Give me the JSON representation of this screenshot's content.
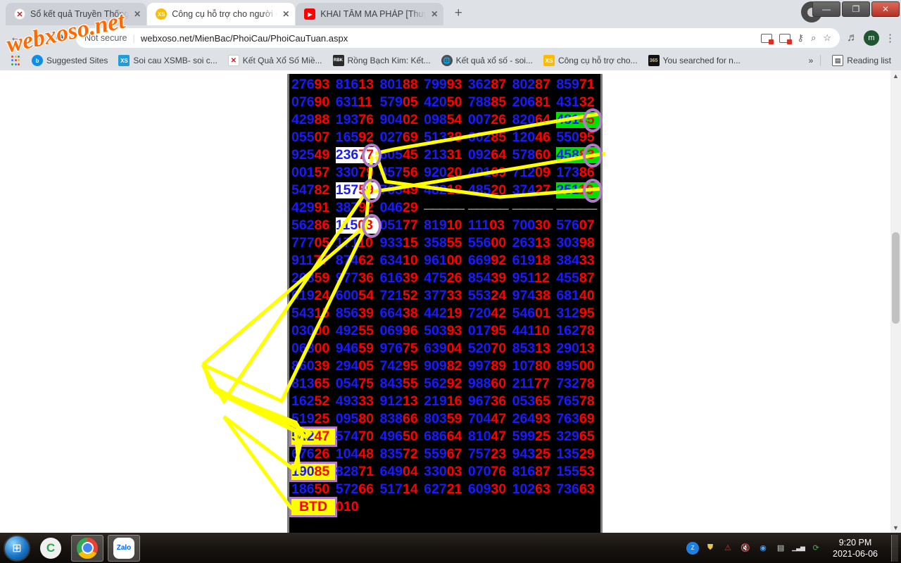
{
  "window": {
    "minimize_label": "—",
    "maximize_label": "❐",
    "close_label": "✕"
  },
  "tabs": [
    {
      "title": "Sổ kết quả Truyền Thống",
      "favicon": "xs-red-icon",
      "active": false,
      "close_label": "✕"
    },
    {
      "title": "Công cụ hỗ trợ cho người chơi xổ",
      "favicon": "xs-yellow-icon",
      "active": true,
      "close_label": "✕"
    },
    {
      "title": "KHAI TÂM MA PHÁP [Thuyết Min",
      "favicon": "youtube-icon",
      "active": false,
      "close_label": "✕"
    }
  ],
  "newtab_label": "+",
  "toolbar": {
    "back_label": "←",
    "forward_label": "→",
    "reload_label": "⟳",
    "security_label": "Not secure",
    "separator": "|",
    "url": "webxoso.net/MienBac/PhoiCau/PhoiCauTuan.aspx",
    "zoom_label": "⌕",
    "bookmark_label": "☆",
    "key_label": "⚷",
    "media_label": "♬",
    "profile_initial": "m",
    "menu_label": "⋮"
  },
  "bookmarks": {
    "apps_label": "",
    "items": [
      {
        "label": "Suggested Sites",
        "icon": "bing-icon"
      },
      {
        "label": "Soi cau XSMB- soi c...",
        "icon": "xs-blue-icon"
      },
      {
        "label": "Kết Quả Xổ Số Miề...",
        "icon": "ketqua-icon"
      },
      {
        "label": "Rồng Bạch Kim: Kết...",
        "icon": "rbk-icon"
      },
      {
        "label": "Kết quả xổ số - soi...",
        "icon": "globe-icon"
      },
      {
        "label": "Công cụ hỗ trợ cho...",
        "icon": "xs-yellow-icon"
      },
      {
        "label": "You searched for n...",
        "icon": "365-icon"
      }
    ],
    "overflow_label": "»",
    "reading_list_label": "Reading list",
    "reading_list_icon": "reading-list-icon"
  },
  "watermark": "webxoso.net",
  "page": {
    "grid": [
      {
        "cells": [
          {
            "b": "276",
            "r": "93"
          },
          {
            "b": "816",
            "r": "13"
          },
          {
            "b": "801",
            "r": "88"
          },
          {
            "b": "799",
            "r": "93"
          },
          {
            "b": "362",
            "r": "87"
          },
          {
            "b": "802",
            "r": "87"
          },
          {
            "b": "859",
            "r": "71"
          }
        ]
      },
      {
        "cells": [
          {
            "b": "076",
            "r": "90"
          },
          {
            "b": "631",
            "r": "11"
          },
          {
            "b": "579",
            "r": "05"
          },
          {
            "b": "420",
            "r": "50"
          },
          {
            "b": "788",
            "r": "85"
          },
          {
            "b": "206",
            "r": "81"
          },
          {
            "b": "431",
            "r": "32"
          }
        ]
      },
      {
        "cells": [
          {
            "b": "429",
            "r": "88"
          },
          {
            "b": "193",
            "r": "76"
          },
          {
            "b": "904",
            "r": "02"
          },
          {
            "b": "098",
            "r": "54"
          },
          {
            "b": "007",
            "r": "26"
          },
          {
            "b": "820",
            "r": "64"
          },
          {
            "b": "481",
            "r": "45",
            "hl": "green",
            "ring": true
          }
        ]
      },
      {
        "cells": [
          {
            "b": "055",
            "r": "07"
          },
          {
            "b": "165",
            "r": "92"
          },
          {
            "b": "027",
            "r": "69"
          },
          {
            "b": "513",
            "r": "38"
          },
          {
            "b": "602",
            "r": "85"
          },
          {
            "b": "120",
            "r": "46"
          },
          {
            "b": "550",
            "r": "95"
          }
        ]
      },
      {
        "cells": [
          {
            "b": "925",
            "r": "49"
          },
          {
            "b": "236",
            "r": "77",
            "hl": "white",
            "ring": true
          },
          {
            "b": "605",
            "r": "45"
          },
          {
            "b": "213",
            "r": "31"
          },
          {
            "b": "092",
            "r": "64"
          },
          {
            "b": "578",
            "r": "60"
          },
          {
            "b": "458",
            "r": "83",
            "hl": "green",
            "ring": true
          }
        ]
      },
      {
        "cells": [
          {
            "b": "001",
            "r": "57"
          },
          {
            "b": "330",
            "r": "79"
          },
          {
            "b": "457",
            "r": "56"
          },
          {
            "b": "920",
            "r": "20"
          },
          {
            "b": "401",
            "r": "69"
          },
          {
            "b": "712",
            "r": "09"
          },
          {
            "b": "173",
            "r": "86"
          }
        ]
      },
      {
        "cells": [
          {
            "b": "547",
            "r": "82"
          },
          {
            "b": "157",
            "r": "59",
            "hl": "white",
            "ring": true
          },
          {
            "b": "763",
            "r": "49"
          },
          {
            "b": "482",
            "r": "18"
          },
          {
            "b": "485",
            "r": "20"
          },
          {
            "b": "374",
            "r": "27"
          },
          {
            "b": "251",
            "r": "19",
            "hl": "green",
            "ring": true
          }
        ]
      },
      {
        "cells": [
          {
            "b": "429",
            "r": "91"
          },
          {
            "b": "387",
            "r": "92"
          },
          {
            "b": "046",
            "r": "29"
          },
          {
            "dash": true
          },
          {
            "dash": true
          },
          {
            "dash": true
          },
          {
            "dash": true
          }
        ]
      },
      {
        "cells": [
          {
            "b": "562",
            "r": "86"
          },
          {
            "b": "115",
            "r": "03",
            "hl": "white",
            "ring": true
          },
          {
            "b": "051",
            "r": "77"
          },
          {
            "b": "819",
            "r": "10"
          },
          {
            "b": "111",
            "r": "03"
          },
          {
            "b": "700",
            "r": "30"
          },
          {
            "b": "576",
            "r": "07"
          }
        ]
      },
      {
        "cells": [
          {
            "b": "777",
            "r": "05"
          },
          {
            "b": "171",
            "r": "10"
          },
          {
            "b": "933",
            "r": "15"
          },
          {
            "b": "358",
            "r": "55"
          },
          {
            "b": "556",
            "r": "00"
          },
          {
            "b": "263",
            "r": "13"
          },
          {
            "b": "303",
            "r": "98"
          }
        ]
      },
      {
        "cells": [
          {
            "b": "911",
            "r": "77"
          },
          {
            "b": "874",
            "r": "62"
          },
          {
            "b": "634",
            "r": "10"
          },
          {
            "b": "961",
            "r": "00"
          },
          {
            "b": "669",
            "r": "92"
          },
          {
            "b": "619",
            "r": "18"
          },
          {
            "b": "384",
            "r": "33"
          }
        ]
      },
      {
        "cells": [
          {
            "b": "208",
            "r": "59"
          },
          {
            "b": "977",
            "r": "36"
          },
          {
            "b": "616",
            "r": "39"
          },
          {
            "b": "475",
            "r": "26"
          },
          {
            "b": "854",
            "r": "39"
          },
          {
            "b": "951",
            "r": "12"
          },
          {
            "b": "455",
            "r": "87"
          }
        ]
      },
      {
        "cells": [
          {
            "b": "619",
            "r": "24"
          },
          {
            "b": "600",
            "r": "54"
          },
          {
            "b": "721",
            "r": "52"
          },
          {
            "b": "377",
            "r": "33"
          },
          {
            "b": "553",
            "r": "24"
          },
          {
            "b": "974",
            "r": "38"
          },
          {
            "b": "681",
            "r": "40"
          }
        ]
      },
      {
        "cells": [
          {
            "b": "543",
            "r": "15"
          },
          {
            "b": "856",
            "r": "39"
          },
          {
            "b": "664",
            "r": "38"
          },
          {
            "b": "442",
            "r": "19"
          },
          {
            "b": "720",
            "r": "42"
          },
          {
            "b": "546",
            "r": "01"
          },
          {
            "b": "312",
            "r": "95"
          }
        ]
      },
      {
        "cells": [
          {
            "b": "030",
            "r": "00"
          },
          {
            "b": "492",
            "r": "55"
          },
          {
            "b": "069",
            "r": "96"
          },
          {
            "b": "503",
            "r": "93"
          },
          {
            "b": "017",
            "r": "95"
          },
          {
            "b": "441",
            "r": "10"
          },
          {
            "b": "162",
            "r": "78"
          }
        ]
      },
      {
        "cells": [
          {
            "b": "068",
            "r": "00"
          },
          {
            "b": "946",
            "r": "59"
          },
          {
            "b": "976",
            "r": "75"
          },
          {
            "b": "639",
            "r": "04"
          },
          {
            "b": "520",
            "r": "70"
          },
          {
            "b": "853",
            "r": "13"
          },
          {
            "b": "290",
            "r": "13"
          }
        ]
      },
      {
        "cells": [
          {
            "b": "860",
            "r": "39"
          },
          {
            "b": "294",
            "r": "05"
          },
          {
            "b": "742",
            "r": "95"
          },
          {
            "b": "909",
            "r": "82"
          },
          {
            "b": "997",
            "r": "89"
          },
          {
            "b": "107",
            "r": "80"
          },
          {
            "b": "895",
            "r": "00"
          }
        ]
      },
      {
        "cells": [
          {
            "b": "813",
            "r": "65"
          },
          {
            "b": "054",
            "r": "75"
          },
          {
            "b": "843",
            "r": "55"
          },
          {
            "b": "562",
            "r": "92"
          },
          {
            "b": "988",
            "r": "60"
          },
          {
            "b": "211",
            "r": "77"
          },
          {
            "b": "732",
            "r": "78"
          }
        ]
      },
      {
        "cells": [
          {
            "b": "162",
            "r": "52"
          },
          {
            "b": "493",
            "r": "33"
          },
          {
            "b": "912",
            "r": "13"
          },
          {
            "b": "219",
            "r": "16"
          },
          {
            "b": "967",
            "r": "36"
          },
          {
            "b": "053",
            "r": "65"
          },
          {
            "b": "765",
            "r": "78"
          }
        ]
      },
      {
        "cells": [
          {
            "b": "519",
            "r": "25"
          },
          {
            "b": "095",
            "r": "80"
          },
          {
            "b": "838",
            "r": "66"
          },
          {
            "b": "803",
            "r": "59"
          },
          {
            "b": "704",
            "r": "47"
          },
          {
            "b": "264",
            "r": "93"
          },
          {
            "b": "763",
            "r": "69"
          }
        ]
      },
      {
        "cells": [
          {
            "b": "542",
            "r": "47",
            "hl": "yellow"
          },
          {
            "b": "574",
            "r": "70"
          },
          {
            "b": "496",
            "r": "50"
          },
          {
            "b": "686",
            "r": "64"
          },
          {
            "b": "810",
            "r": "47"
          },
          {
            "b": "599",
            "r": "25"
          },
          {
            "b": "329",
            "r": "65"
          }
        ]
      },
      {
        "cells": [
          {
            "b": "676",
            "r": "26"
          },
          {
            "b": "104",
            "r": "48"
          },
          {
            "b": "835",
            "r": "72"
          },
          {
            "b": "559",
            "r": "67"
          },
          {
            "b": "757",
            "r": "23"
          },
          {
            "b": "943",
            "r": "25"
          },
          {
            "b": "135",
            "r": "29"
          }
        ]
      },
      {
        "cells": [
          {
            "b": "190",
            "r": "85",
            "hl": "yellow"
          },
          {
            "b": "828",
            "r": "71"
          },
          {
            "b": "649",
            "r": "04"
          },
          {
            "b": "330",
            "r": "03"
          },
          {
            "b": "070",
            "r": "76"
          },
          {
            "b": "816",
            "r": "87"
          },
          {
            "b": "155",
            "r": "53"
          }
        ]
      },
      {
        "cells": [
          {
            "b": "186",
            "r": "50"
          },
          {
            "b": "572",
            "r": "66"
          },
          {
            "b": "517",
            "r": "14"
          },
          {
            "b": "627",
            "r": "21"
          },
          {
            "b": "609",
            "r": "30"
          },
          {
            "b": "102",
            "r": "63"
          },
          {
            "b": "736",
            "r": "63"
          }
        ]
      },
      {
        "cells": [
          {
            "btd": "BTD"
          },
          {
            "r": "010",
            "plain": true
          }
        ]
      }
    ],
    "colors": {
      "blue": "#1a1aff",
      "red": "#ff0000",
      "highlight_green": "#00e000",
      "highlight_white": "#ffffff",
      "highlight_yellow": "#ffff00",
      "ring": "#b07cc6",
      "line": "#ffff00",
      "background": "#000000"
    }
  },
  "scrollbar": {
    "up_label": "▲",
    "down_label": "▼"
  },
  "taskbar": {
    "start_label": "⊞",
    "items": [
      {
        "name": "coccoc",
        "label": "C"
      },
      {
        "name": "chrome",
        "label": ""
      },
      {
        "name": "zalo",
        "label": "Zalo"
      }
    ],
    "tray": [
      {
        "name": "zalo-tray-icon",
        "label": "Z"
      },
      {
        "name": "shield-icon",
        "label": "⛊"
      },
      {
        "name": "network-disconnected-icon",
        "label": "⚠"
      },
      {
        "name": "volume-muted-icon",
        "label": "🔇"
      },
      {
        "name": "browser-tray-icon",
        "label": "◉"
      },
      {
        "name": "ime-icon",
        "label": "▤"
      },
      {
        "name": "signal-icon",
        "label": "▁▃▅"
      },
      {
        "name": "update-icon",
        "label": "⟳"
      }
    ],
    "clock_time": "9:20 PM",
    "clock_date": "2021-06-06"
  }
}
